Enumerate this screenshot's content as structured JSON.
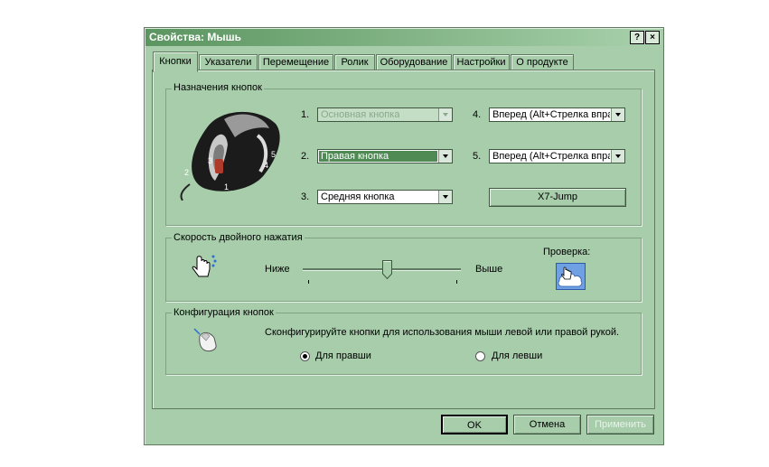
{
  "window": {
    "title": "Свойства: Мышь",
    "help_btn": "?",
    "close_btn": "×"
  },
  "tabs": [
    "Кнопки",
    "Указатели",
    "Перемещение",
    "Ролик",
    "Оборудование",
    "Настройки",
    "О продукте"
  ],
  "assign": {
    "group_label": "Назначения кнопок",
    "items": [
      {
        "num": "1.",
        "value": "Основная кнопка"
      },
      {
        "num": "2.",
        "value": "Правая кнопка"
      },
      {
        "num": "3.",
        "value": "Средняя кнопка"
      },
      {
        "num": "4.",
        "value": "Вперед (Alt+Стрелка впра"
      },
      {
        "num": "5.",
        "value": "Вперед (Alt+Стрелка впра"
      }
    ],
    "x7_button": "X7-Jump",
    "mouse_numbers": [
      "2",
      "3",
      "5",
      "4",
      "1"
    ]
  },
  "double_click": {
    "group_label": "Скорость двойного нажатия",
    "slow": "Ниже",
    "fast": "Выше",
    "test_label": "Проверка:",
    "speed_fraction": 0.53
  },
  "config": {
    "group_label": "Конфигурация кнопок",
    "description": "Сконфигурируйте кнопки для использования мыши левой или правой рукой.",
    "right_hand": "Для правши",
    "left_hand": "Для левши",
    "selected": "right"
  },
  "footer": {
    "ok": "OK",
    "cancel": "Отмена",
    "apply": "Применить"
  }
}
